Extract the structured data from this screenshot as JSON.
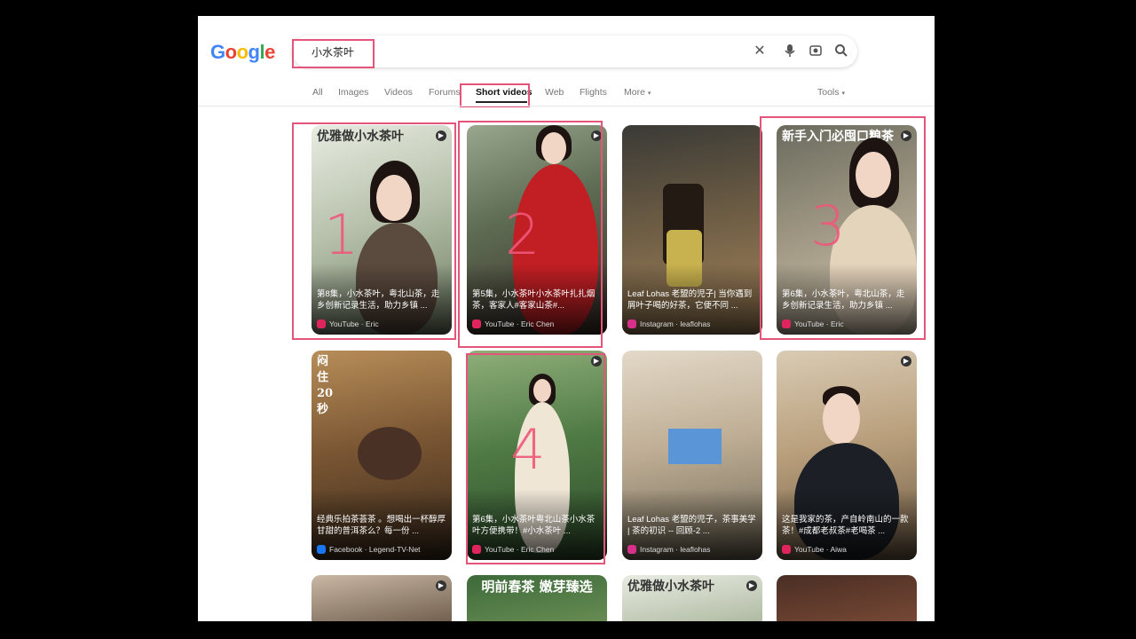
{
  "logo": {
    "text": [
      "G",
      "o",
      "o",
      "g",
      "l",
      "e"
    ],
    "colors": [
      "#4285F4",
      "#EA4335",
      "#FBBC05",
      "#4285F4",
      "#34A853",
      "#EA4335"
    ]
  },
  "search": {
    "query": "小水茶叶",
    "clear_icon": "close-icon",
    "mic_icon": "mic-icon",
    "lens_icon": "camera-lens-icon",
    "search_icon": "search-icon"
  },
  "tabs": [
    {
      "label": "All"
    },
    {
      "label": "Images"
    },
    {
      "label": "Videos"
    },
    {
      "label": "Forums"
    },
    {
      "label": "Short videos",
      "active": true
    },
    {
      "label": "Web"
    },
    {
      "label": "Flights"
    },
    {
      "label": "More"
    }
  ],
  "tools_label": "Tools",
  "annotations": [
    "1",
    "2",
    "3",
    "4"
  ],
  "accent_color": "#e5557a",
  "cards": [
    {
      "overlay": "优雅做小水茶叶",
      "title": "第8集，小水茶叶，粤北山茶，走乡创新记录生活，助力乡镇 ...",
      "source": "YouTube · Eric",
      "source_type": "youtube"
    },
    {
      "overlay": "",
      "title": "第5集，小水茶叶小水茶叶扎扎烟茶，客家人#客家山茶#...",
      "source": "YouTube · Eric Chen",
      "source_type": "youtube"
    },
    {
      "overlay": "",
      "title": "Leaf Lohas 老盟的児子| 当你遇到屑叶子喝的好茶，它便不同 ...",
      "source": "Instagram · leaflohas",
      "source_type": "instagram"
    },
    {
      "overlay": "新手入门必囤口粮茶",
      "title": "第6集，小水茶叶，粤北山茶，走乡创新记录生活，助力乡镇 ...",
      "source": "YouTube · Eric",
      "source_type": "youtube"
    },
    {
      "overlay": "闷住20秒",
      "title": "经典乐拍茶荟茶 。想喝出一杯醇厚甘甜的普洱茶么？每一份 ...",
      "source": "Facebook · Legend-TV-Net",
      "source_type": "facebook"
    },
    {
      "overlay": "",
      "title": "第6集，小水茶叶粤北山茶小水茶叶方便携带！#小水茶叶 ...",
      "source": "YouTube · Eric Chen",
      "source_type": "youtube"
    },
    {
      "overlay": "",
      "title": "Leaf Lohas 老盟的児子，茶事美学 | 茶的初识 -- 回顾-2 ...",
      "source": "Instagram · leaflohas",
      "source_type": "instagram"
    },
    {
      "overlay": "",
      "title": "这是我家的茶，产自岭南山的一款茶！#成都老叔茶#老喝茶 ...",
      "source": "YouTube · Aiwa",
      "source_type": "youtube"
    },
    {
      "overlay": "",
      "title": "",
      "source": "",
      "source_type": ""
    },
    {
      "overlay": "明前春茶 嫩芽臻选",
      "title": "",
      "source": "",
      "source_type": ""
    },
    {
      "overlay": "优雅做小水茶叶",
      "title": "",
      "source": "",
      "source_type": ""
    },
    {
      "overlay": "",
      "title": "",
      "source": "",
      "source_type": ""
    }
  ]
}
